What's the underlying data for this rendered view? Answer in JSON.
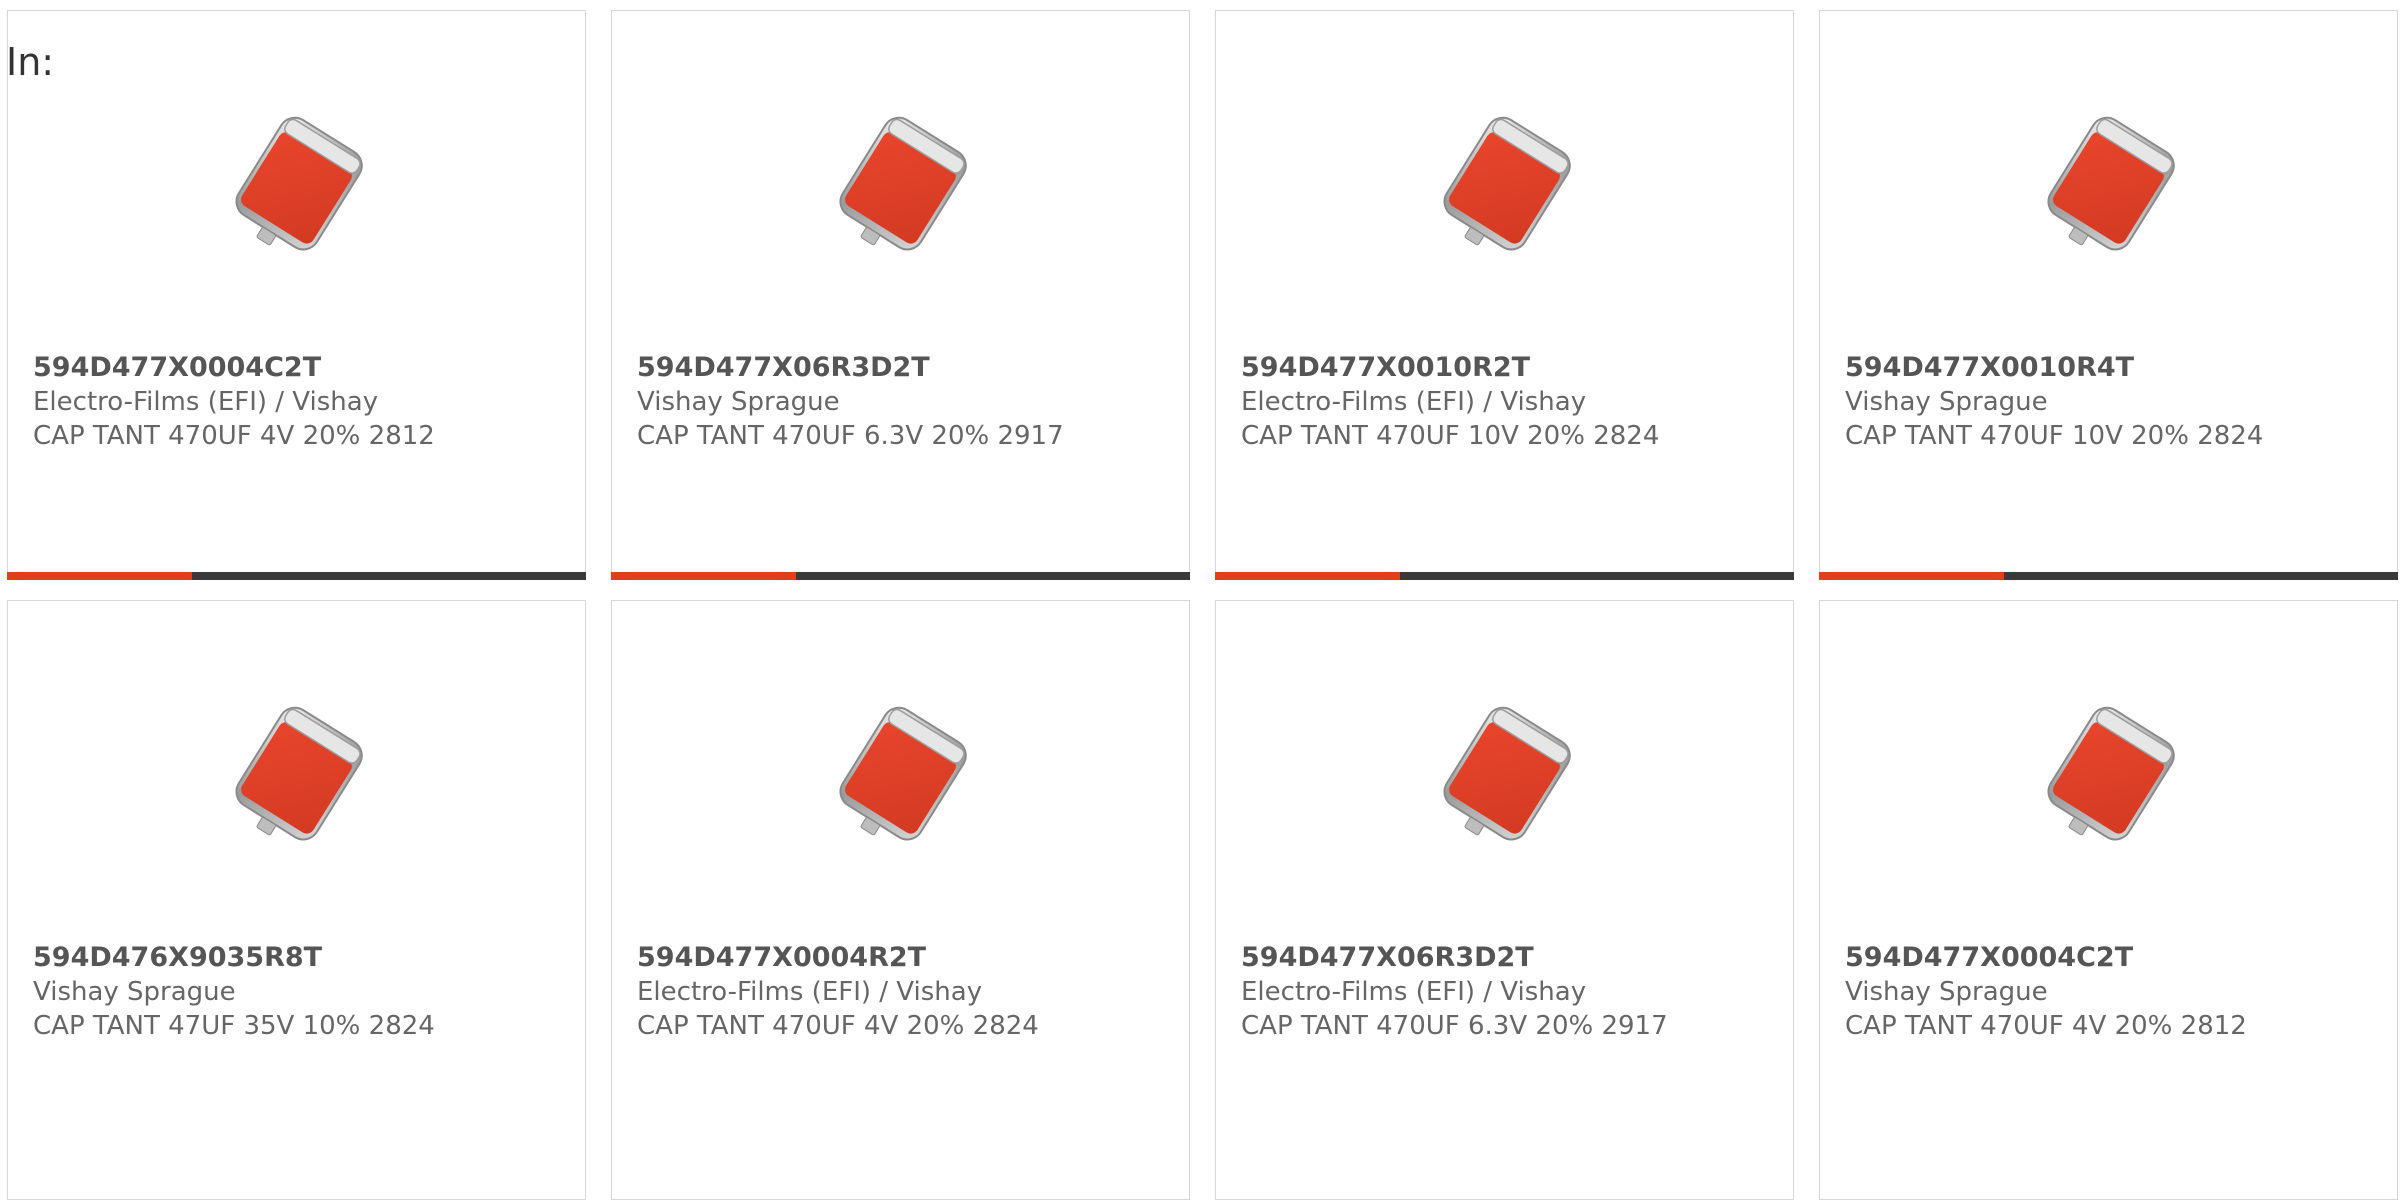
{
  "header": {
    "in_label": "In:"
  },
  "colors": {
    "accent": "#e0401c",
    "track": "#3a3a3a",
    "capacitor_body": "#e8452c",
    "text_primary": "#555555",
    "text_secondary": "#666666",
    "card_border": "#d7d7d7"
  },
  "products": [
    {
      "part_number": "594D477X0004C2T",
      "manufacturer": "Electro-Films (EFI) / Vishay",
      "description": "CAP TANT 470UF 4V 20% 2812",
      "image_icon": "tantalum-capacitor-icon",
      "progress_fraction": 0.32
    },
    {
      "part_number": "594D477X06R3D2T",
      "manufacturer": "Vishay Sprague",
      "description": "CAP TANT 470UF 6.3V 20% 2917",
      "image_icon": "tantalum-capacitor-icon",
      "progress_fraction": 0.32
    },
    {
      "part_number": "594D477X0010R2T",
      "manufacturer": "Electro-Films (EFI) / Vishay",
      "description": "CAP TANT 470UF 10V 20% 2824",
      "image_icon": "tantalum-capacitor-icon",
      "progress_fraction": 0.32
    },
    {
      "part_number": "594D477X0010R4T",
      "manufacturer": "Vishay Sprague",
      "description": "CAP TANT 470UF 10V 20% 2824",
      "image_icon": "tantalum-capacitor-icon",
      "progress_fraction": 0.32
    },
    {
      "part_number": "594D476X9035R8T",
      "manufacturer": "Vishay Sprague",
      "description": "CAP TANT 47UF 35V 10% 2824",
      "image_icon": "tantalum-capacitor-icon"
    },
    {
      "part_number": "594D477X0004R2T",
      "manufacturer": "Electro-Films (EFI) / Vishay",
      "description": "CAP TANT 470UF 4V 20% 2824",
      "image_icon": "tantalum-capacitor-icon"
    },
    {
      "part_number": "594D477X06R3D2T",
      "manufacturer": "Electro-Films (EFI) / Vishay",
      "description": "CAP TANT 470UF 6.3V 20% 2917",
      "image_icon": "tantalum-capacitor-icon"
    },
    {
      "part_number": "594D477X0004C2T",
      "manufacturer": "Vishay Sprague",
      "description": "CAP TANT 470UF 4V 20% 2812",
      "image_icon": "tantalum-capacitor-icon"
    }
  ]
}
